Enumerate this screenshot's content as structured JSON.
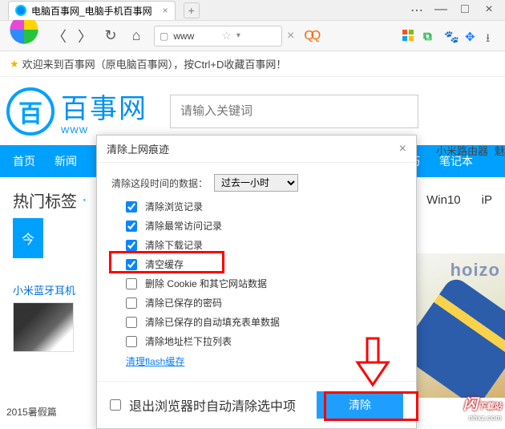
{
  "browser": {
    "tab_title": "电脑百事网_电脑手机百事网",
    "url_text": "www",
    "nav_links": [
      "小米路由器",
      "魅"
    ]
  },
  "banner_text": "欢迎来到百事网（原电脑百事网），按Ctrl+D收藏百事网！",
  "brand": {
    "logo_char": "百",
    "title": "百事网",
    "sub": "WWW"
  },
  "search": {
    "placeholder": "请输入关键词"
  },
  "nav": {
    "items": [
      "首页",
      "新闻"
    ],
    "right": [
      "技巧",
      "笔记本"
    ]
  },
  "tags": {
    "label": "热门标签",
    "right": [
      "Win10",
      "iP"
    ]
  },
  "today_label": "今",
  "product_link": "小米蓝牙耳机",
  "bottom_line": "2015暑假篇",
  "promo_brand": "hoizo",
  "dialog": {
    "title": "清除上网痕迹",
    "range_label": "清除这段时间的数据：",
    "range_value": "过去一小时",
    "options": [
      {
        "label": "清除浏览记录",
        "checked": true
      },
      {
        "label": "清除最常访问记录",
        "checked": true
      },
      {
        "label": "清除下载记录",
        "checked": true
      },
      {
        "label": "清空缓存",
        "checked": true
      },
      {
        "label": "删除 Cookie 和其它网站数据",
        "checked": false
      },
      {
        "label": "清除已保存的密码",
        "checked": false
      },
      {
        "label": "清除已保存的自动填充表单数据",
        "checked": false
      },
      {
        "label": "清除地址栏下拉列表",
        "checked": false
      }
    ],
    "flash_link": "清理flash缓存",
    "auto_label": "退出浏览器时自动清除选中项",
    "clear_btn": "清除"
  },
  "watermark": {
    "main": "闪",
    "sub": "下载站",
    "url": "nhxz.com"
  }
}
